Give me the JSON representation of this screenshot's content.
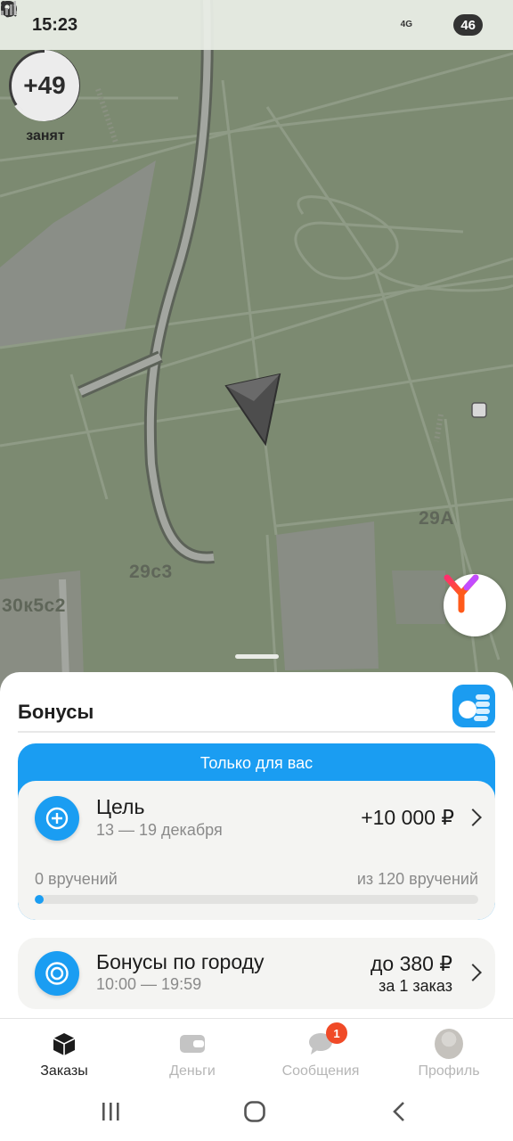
{
  "status_bar": {
    "time": "15:23",
    "network": "4G",
    "battery": "46"
  },
  "map": {
    "busy_widget": {
      "value": "+49",
      "label": "занят"
    },
    "labels": [
      "29А",
      "29с3",
      "30к5с2"
    ]
  },
  "bonuses": {
    "title": "Бонусы",
    "exclusive_title": "Только для вас",
    "goal": {
      "title": "Цель",
      "dates": "13 — 19 декабря",
      "amount": "+10 000 ₽",
      "progress_left": "0 вручений",
      "progress_right": "из 120 вручений",
      "progress_fraction": 0
    },
    "city": {
      "title": "Бонусы по городу",
      "hours": "10:00 — 19:59",
      "amount": "до 380 ₽",
      "amount_sub": "за 1 заказ"
    }
  },
  "bottom_nav": {
    "items": [
      {
        "label": "Заказы",
        "icon": "orders-box-icon",
        "active": true
      },
      {
        "label": "Деньги",
        "icon": "wallet-icon",
        "active": false
      },
      {
        "label": "Сообщения",
        "icon": "chat-icon",
        "active": false,
        "badge": "1"
      },
      {
        "label": "Профиль",
        "icon": "avatar",
        "active": false
      }
    ]
  },
  "colors": {
    "accent": "#1a9df2",
    "map_green": "#7c8a71",
    "badge": "#f04a27"
  }
}
